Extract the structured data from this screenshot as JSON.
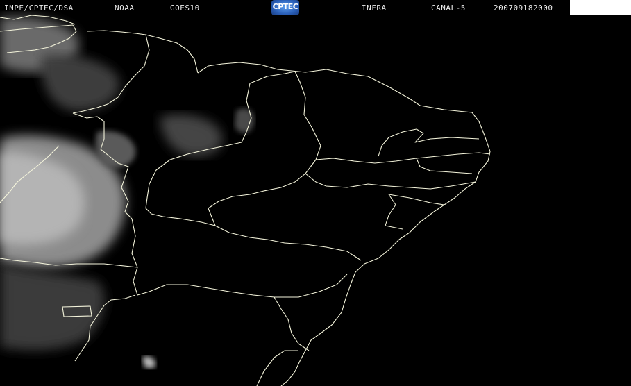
{
  "header": {
    "source": "INPE/CPTEC/DSA",
    "agency": "NOAA",
    "satellite": "GOES10",
    "logo_text": "CPTEC",
    "product": "INFRA",
    "channel": "CANAL-5",
    "timestamp": "200709182000"
  },
  "colors": {
    "background": "#000000",
    "borders": "#f5f5dc",
    "clouds": "#9a9a9a",
    "logo": "#2a5fb8"
  }
}
